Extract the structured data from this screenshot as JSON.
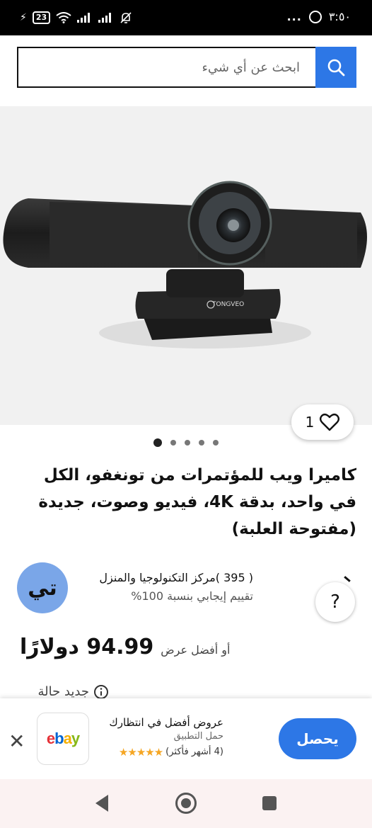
{
  "status_bar": {
    "battery": "23",
    "time": "٣:٥٠",
    "dots": "..."
  },
  "search": {
    "placeholder": "ابحث عن أي شيء"
  },
  "product": {
    "watch_count": "1",
    "image_count": 5,
    "title": "كاميرا ويب للمؤتمرات من تونغفو، الكل في واحد، بدقة 4K، فيديو وصوت، جديدة (مفتوحة العلبة)",
    "brand_on_device": "TONGVEO"
  },
  "seller": {
    "name": "( 395 )مركز التكنولوجيا والمنزل",
    "rating": "تقييم إيجابي بنسبة 100%",
    "avatar_initials": "تي",
    "help_label": "?"
  },
  "price": {
    "amount": "94.99 دولارًا",
    "best_offer": "أو أفضل عرض"
  },
  "condition_peek": "جديد حالة",
  "app_banner": {
    "title": "عروض أفضل في انتظارك",
    "subtitle": "حمل التطبيق",
    "rating_text": "(4 أشهر فأكثر)",
    "stars": "★★★★★",
    "get_label": "يحصل",
    "close_label": "✕",
    "logo_letters": [
      "e",
      "b",
      "a",
      "y"
    ]
  },
  "colors": {
    "accent_blue": "#2d77e6",
    "ebay_e": "#e53238",
    "ebay_b": "#0064d2",
    "ebay_a": "#f5af02",
    "ebay_y": "#86b817",
    "star": "#f5a623"
  }
}
